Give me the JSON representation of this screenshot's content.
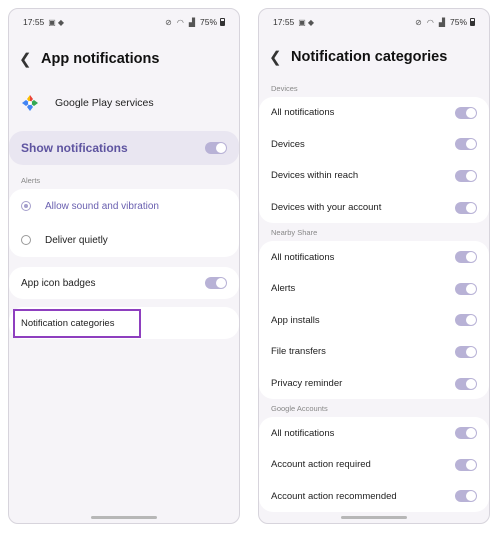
{
  "status_bar": {
    "time": "17:55",
    "battery": "75%"
  },
  "left": {
    "title": "App notifications",
    "app_name": "Google Play services",
    "show_notifications": {
      "label": "Show notifications",
      "on": true
    },
    "alerts_section": "Alerts",
    "alert_options": [
      {
        "label": "Allow sound and vibration",
        "selected": true
      },
      {
        "label": "Deliver quietly",
        "selected": false
      }
    ],
    "app_icon_badges": {
      "label": "App icon badges",
      "on": true
    },
    "notification_categories": "Notification categories"
  },
  "right": {
    "title": "Notification categories",
    "sections": [
      {
        "label": "Devices",
        "items": [
          "All notifications",
          "Devices",
          "Devices within reach",
          "Devices with your account"
        ]
      },
      {
        "label": "Nearby Share",
        "items": [
          "All notifications",
          "Alerts",
          "App installs",
          "File transfers",
          "Privacy reminder"
        ]
      },
      {
        "label": "Google Accounts",
        "items": [
          "All notifications",
          "Account action required",
          "Account action recommended"
        ]
      }
    ]
  },
  "colors": {
    "accent": "#5e54a0",
    "toggle_on": "#b8b2d6",
    "highlight_border": "#8e3fbf"
  }
}
